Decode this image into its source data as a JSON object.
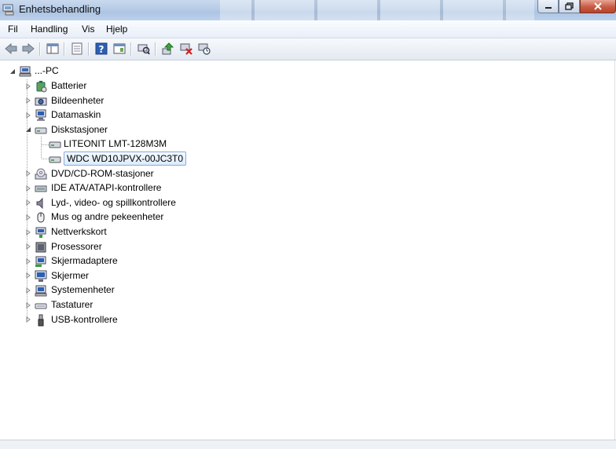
{
  "window": {
    "title": "Enhetsbehandling"
  },
  "menu": {
    "items": [
      "Fil",
      "Handling",
      "Vis",
      "Hjelp"
    ]
  },
  "toolbar": {
    "buttons": [
      "back-icon",
      "forward-icon",
      "console-tree-icon",
      "properties-icon",
      "help-icon",
      "action-pane-icon",
      "scan-hardware-icon",
      "update-driver-icon",
      "uninstall-icon",
      "disable-icon"
    ]
  },
  "tree": {
    "root": "...-PC",
    "categories": [
      {
        "label": "Batterier",
        "icon": "battery-icon"
      },
      {
        "label": "Bildeenheter",
        "icon": "imaging-device-icon"
      },
      {
        "label": "Datamaskin",
        "icon": "computer-icon"
      },
      {
        "label": "Diskstasjoner",
        "icon": "disk-drive-icon",
        "expanded": true,
        "children": [
          "LITEONIT LMT-128M3M",
          "WDC WD10JPVX-00JC3T0"
        ]
      },
      {
        "label": "DVD/CD-ROM-stasjoner",
        "icon": "dvd-drive-icon"
      },
      {
        "label": "IDE ATA/ATAPI-kontrollere",
        "icon": "ide-controller-icon"
      },
      {
        "label": "Lyd-, video- og spillkontrollere",
        "icon": "speaker-icon"
      },
      {
        "label": "Mus og andre pekeenheter",
        "icon": "mouse-icon"
      },
      {
        "label": "Nettverkskort",
        "icon": "network-adapter-icon"
      },
      {
        "label": "Prosessorer",
        "icon": "processor-icon"
      },
      {
        "label": "Skjermadaptere",
        "icon": "display-adapter-icon"
      },
      {
        "label": "Skjermer",
        "icon": "monitor-icon"
      },
      {
        "label": "Systemenheter",
        "icon": "system-devices-icon"
      },
      {
        "label": "Tastaturer",
        "icon": "keyboard-icon"
      },
      {
        "label": "USB-kontrollere",
        "icon": "usb-controller-icon"
      }
    ],
    "selected": "WDC WD10JPVX-00JC3T0"
  },
  "colors": {
    "selection_border": "#84acdd",
    "titlebar": "#b8cde7"
  }
}
